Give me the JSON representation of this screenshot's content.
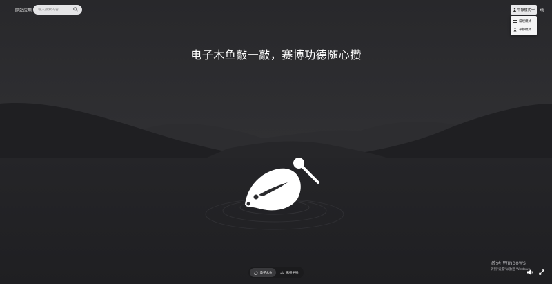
{
  "header": {
    "menu_label": "网站应用",
    "search_placeholder": "输入搜索内容"
  },
  "mode": {
    "selected": "平静模式",
    "options": [
      {
        "label": "常规模式",
        "icon": "grid-icon"
      },
      {
        "label": "平静模式",
        "icon": "meditation-icon"
      }
    ]
  },
  "main": {
    "title": "电子木鱼敲一敲，赛博功德随心攒"
  },
  "tabs": [
    {
      "label": "电子木鱼",
      "icon": "muyu-icon",
      "active": true
    },
    {
      "label": "佛祖坐禅",
      "icon": "lotus-icon",
      "active": false
    }
  ],
  "watermark": {
    "title": "激活 Windows",
    "subtitle": "转到\"设置\"以激活 Windows。"
  },
  "colors": {
    "background": "#2b2b2e",
    "hills": "#1e1e21",
    "water": "#232326",
    "text": "#ffffff"
  }
}
